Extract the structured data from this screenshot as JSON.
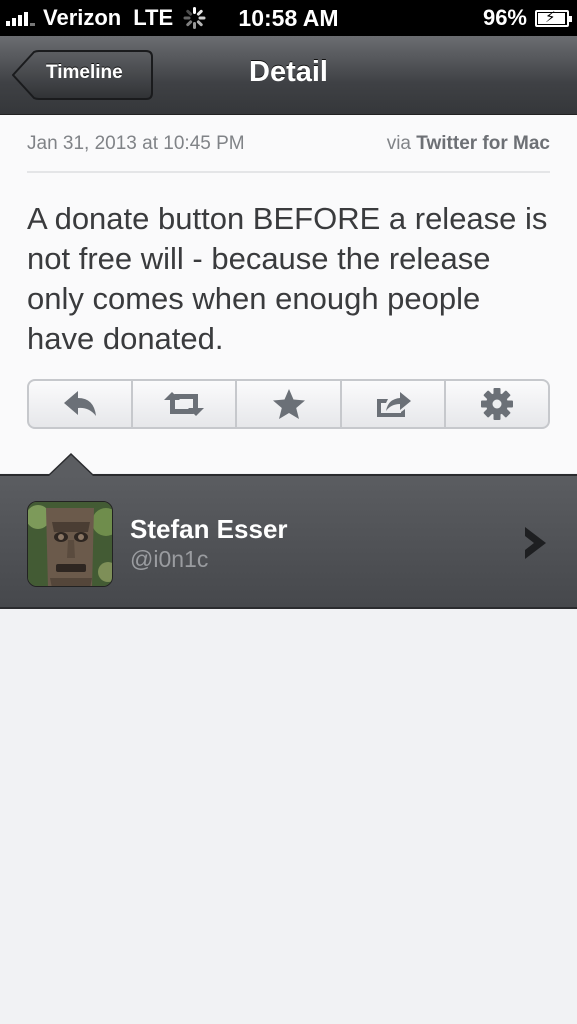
{
  "status_bar": {
    "carrier": "Verizon",
    "network": "LTE",
    "time": "10:58 AM",
    "battery": "96%"
  },
  "nav": {
    "back_label": "Timeline",
    "title": "Detail"
  },
  "tweet": {
    "date": "Jan 31, 2013 at 10:45 PM",
    "via_prefix": "via",
    "via_app": "Twitter for Mac",
    "text": "A donate button BEFORE a release is not free will - because the release only comes when enough people have donated."
  },
  "actions": [
    {
      "name": "reply",
      "icon": "reply-icon"
    },
    {
      "name": "retweet",
      "icon": "retweet-icon"
    },
    {
      "name": "favorite",
      "icon": "star-icon"
    },
    {
      "name": "share",
      "icon": "share-icon"
    },
    {
      "name": "more",
      "icon": "gear-icon"
    }
  ],
  "user": {
    "name": "Stefan Esser",
    "handle": "@i0n1c"
  },
  "colors": {
    "icon_gray": "#6b7077",
    "nav_dark": "#3f4145",
    "text_dark": "#3a3b3d"
  }
}
